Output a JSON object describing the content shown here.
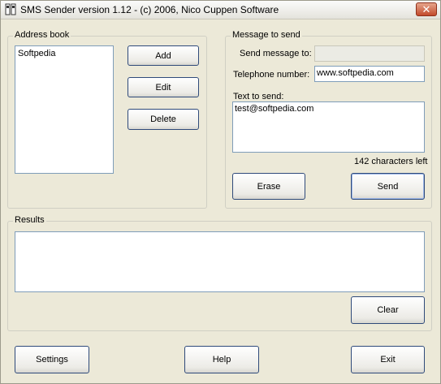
{
  "window": {
    "title": "SMS Sender version 1.12  -  (c) 2006, Nico Cuppen Software",
    "close_label": "✕"
  },
  "address_book": {
    "label": "Address book",
    "items": [
      "Softpedia"
    ],
    "add_label": "Add",
    "edit_label": "Edit",
    "delete_label": "Delete"
  },
  "message": {
    "label": "Message to send",
    "send_to_label": "Send message to:",
    "send_to_value": "",
    "phone_label": "Telephone number:",
    "phone_value": "www.softpedia.com",
    "text_label": "Text to send:",
    "text_value": "test@softpedia.com",
    "chars_left": "142 characters left",
    "erase_label": "Erase",
    "send_label": "Send"
  },
  "results": {
    "label": "Results",
    "value": "",
    "clear_label": "Clear"
  },
  "footer": {
    "settings_label": "Settings",
    "help_label": "Help",
    "exit_label": "Exit"
  },
  "colors": {
    "window_bg": "#ece9d8",
    "button_border": "#2f4a7a",
    "field_border": "#7f9db9"
  }
}
